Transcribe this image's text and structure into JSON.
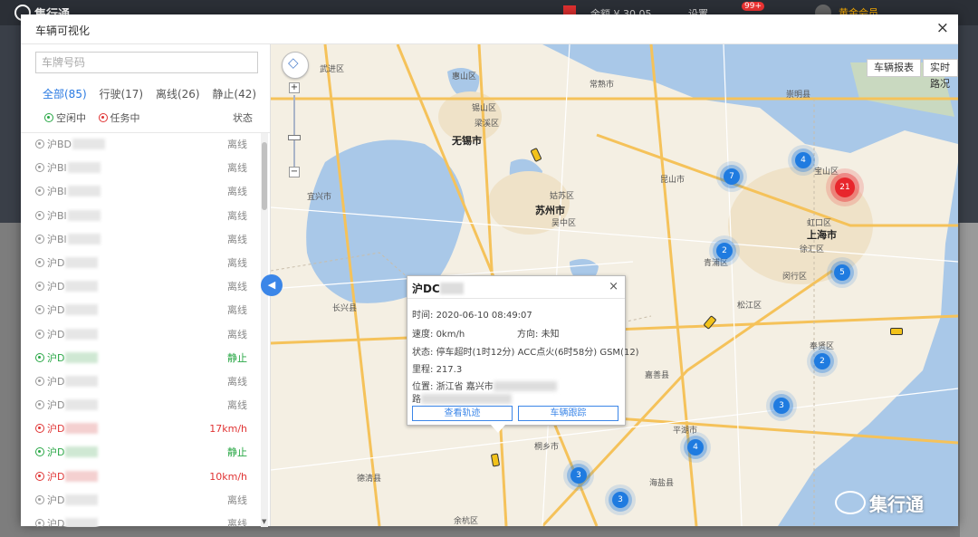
{
  "background": {
    "logo_text": "集行通",
    "items": [
      "余额 ¥ 30.05",
      "设置"
    ],
    "badge": "99+",
    "user": "黄金会员"
  },
  "modal": {
    "title": "车辆可视化",
    "close": "×"
  },
  "search": {
    "placeholder": "车牌号码"
  },
  "tabs": [
    "全部(85)",
    "行驶(17)",
    "离线(26)",
    "静止(42)"
  ],
  "legend": {
    "idle": "空闲中",
    "task": "任务中",
    "status_header": "状态"
  },
  "vehicles": [
    {
      "plate": "沪BD",
      "status": "离线",
      "state": "grey"
    },
    {
      "plate": "沪Bl",
      "status": "离线",
      "state": "grey"
    },
    {
      "plate": "沪Bl",
      "status": "离线",
      "state": "grey"
    },
    {
      "plate": "沪Bl",
      "status": "离线",
      "state": "grey"
    },
    {
      "plate": "沪Bl",
      "status": "离线",
      "state": "grey"
    },
    {
      "plate": "沪D",
      "status": "离线",
      "state": "grey"
    },
    {
      "plate": "沪D",
      "status": "离线",
      "state": "grey"
    },
    {
      "plate": "沪D",
      "status": "离线",
      "state": "grey"
    },
    {
      "plate": "沪D",
      "status": "离线",
      "state": "grey"
    },
    {
      "plate": "沪D",
      "status": "静止",
      "state": "green"
    },
    {
      "plate": "沪D",
      "status": "离线",
      "state": "grey"
    },
    {
      "plate": "沪D",
      "status": "离线",
      "state": "grey"
    },
    {
      "plate": "沪D",
      "status": "17km/h",
      "state": "red"
    },
    {
      "plate": "沪D",
      "status": "静止",
      "state": "green"
    },
    {
      "plate": "沪D",
      "status": "10km/h",
      "state": "red"
    },
    {
      "plate": "沪D",
      "status": "离线",
      "state": "grey"
    },
    {
      "plate": "沪D",
      "status": "离线",
      "state": "grey"
    }
  ],
  "map": {
    "buttons": {
      "vehicle_report": "车辆报表",
      "realtime_traffic": "实时路况"
    },
    "zoom_in": "+",
    "zoom_out": "−",
    "labels": [
      {
        "t": "武进区"
      },
      {
        "t": "惠山区"
      },
      {
        "t": "锡山区"
      },
      {
        "t": "梁溪区"
      },
      {
        "t": "无锡市",
        "city": true
      },
      {
        "t": "常熟市"
      },
      {
        "t": "崇明县"
      },
      {
        "t": "宝山区"
      },
      {
        "t": "昆山市"
      },
      {
        "t": "姑苏区"
      },
      {
        "t": "苏州市",
        "city": true
      },
      {
        "t": "吴中区"
      },
      {
        "t": "宜兴市"
      },
      {
        "t": "虹口区"
      },
      {
        "t": "上海市",
        "city": true
      },
      {
        "t": "青浦区"
      },
      {
        "t": "徐汇区"
      },
      {
        "t": "闵行区"
      },
      {
        "t": "长兴县"
      },
      {
        "t": "松江区"
      },
      {
        "t": "奉贤区"
      },
      {
        "t": "嘉善县"
      },
      {
        "t": "平湖市"
      },
      {
        "t": "桐乡市"
      },
      {
        "t": "德清县"
      },
      {
        "t": "海盐县"
      },
      {
        "t": "余杭区"
      }
    ],
    "clusters": [
      "4",
      "7",
      "21",
      "2",
      "5",
      "2",
      "3",
      "4",
      "3",
      "3"
    ]
  },
  "popup": {
    "plate": "沪DC",
    "close": "×",
    "time_label": "时间:",
    "time": "2020-06-10 08:49:07",
    "speed_label": "速度:",
    "speed": "0km/h",
    "direction_label": "方向:",
    "direction": "未知",
    "status_label": "状态:",
    "status": "停车超时(1时12分) ACC点火(6时58分) GSM(12)",
    "mileage_label": "里程:",
    "mileage": "217.3",
    "location_label": "位置:",
    "location": "浙江省 嘉兴市",
    "location_line2": "路",
    "btn_track": "查看轨迹",
    "btn_follow": "车辆跟踪"
  },
  "watermark": "集行通"
}
